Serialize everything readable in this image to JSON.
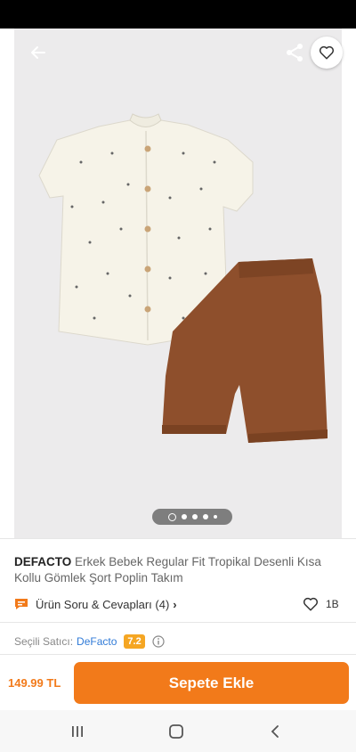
{
  "product": {
    "brand": "DEFACTO",
    "name": "Erkek Bebek Regular Fit Tropikal Desenli Kısa Kollu Gömlek Şort Poplin Takım"
  },
  "gallery": {
    "image_count": 5,
    "active_index": 0,
    "icons": {
      "back": "arrow-left-icon",
      "share": "share-icon",
      "favorite": "heart-outline-icon"
    }
  },
  "qa": {
    "label": "Ürün Soru & Cevapları (4)",
    "chevron": "›"
  },
  "likes": {
    "count": "1B"
  },
  "seller": {
    "label": "Seçili Satıcı:",
    "name": "DeFacto",
    "score": "7.2"
  },
  "purchase": {
    "price": "149.99 TL",
    "button_label": "Sepete Ekle"
  },
  "colors": {
    "accent": "#f27a1a",
    "link": "#2f7ad7",
    "score": "#f5a623"
  },
  "nav": {
    "icons": [
      "recent-apps-icon",
      "home-icon",
      "back-icon"
    ]
  }
}
